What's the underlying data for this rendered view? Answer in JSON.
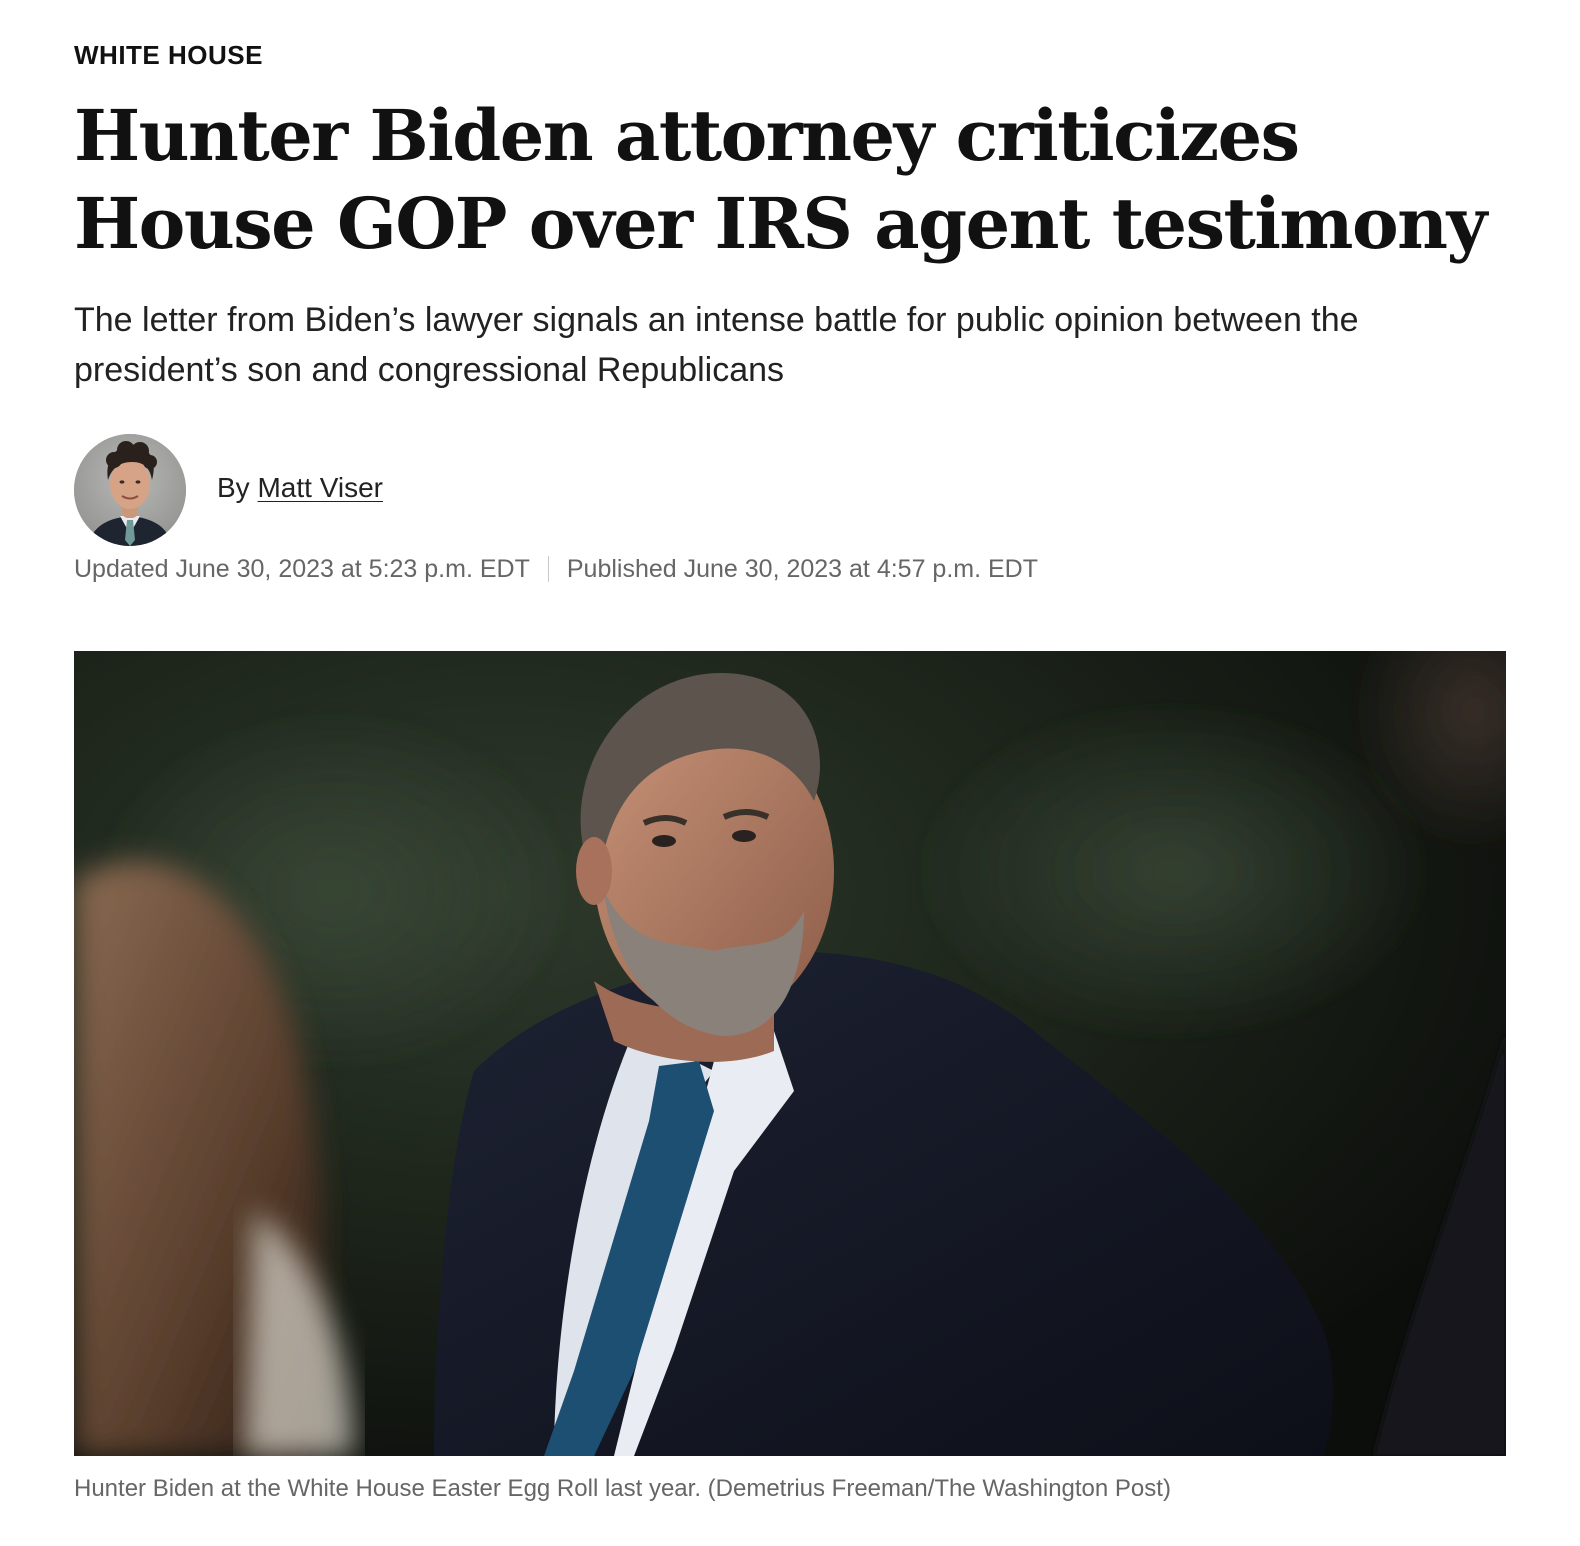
{
  "article": {
    "section": "WHITE HOUSE",
    "headline": "Hunter Biden attorney criticizes House GOP over IRS agent testimony",
    "subheadline": "The letter from Biden’s lawyer signals an intense battle for public opinion between the president’s son and congressional Republicans",
    "byline": {
      "prefix": "By",
      "author": "Matt Viser"
    },
    "dates": {
      "updated": "Updated June 30, 2023 at 5:23 p.m. EDT",
      "published": "Published June 30, 2023 at 4:57 p.m. EDT"
    },
    "photo": {
      "caption": "Hunter Biden at the White House Easter Egg Roll last year. (Demetrius Freeman/The Washington Post)"
    }
  }
}
